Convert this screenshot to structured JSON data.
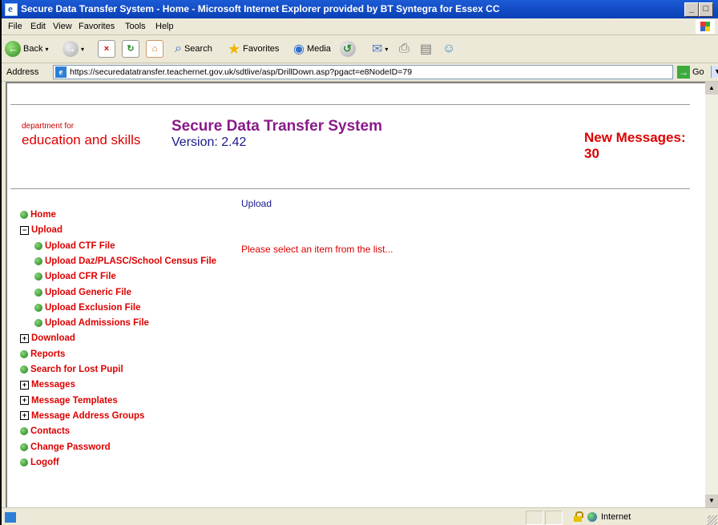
{
  "window": {
    "title": "Secure Data Transfer System - Home - Microsoft Internet Explorer provided by BT Syntegra for Essex CC"
  },
  "menu": [
    "File",
    "Edit",
    "View",
    "Favorites",
    "Tools",
    "Help"
  ],
  "toolbar": {
    "back_label": "Back",
    "search_label": "Search",
    "favorites_label": "Favorites",
    "media_label": "Media"
  },
  "address": {
    "label": "Address",
    "url": "https://securedatatransfer.teachernet.gov.uk/sdtlive/asp/DrillDown.asp?pgact=e8NodeID=79",
    "go_label": "Go"
  },
  "header": {
    "dept_small": "department for",
    "dept_large": "education and skills",
    "system_title": "Secure Data Transfer System",
    "version": "Version: 2.42",
    "new_messages_label": "New Messages:",
    "new_messages_count": "30"
  },
  "nav": [
    {
      "label": "Home",
      "type": "dot",
      "indent": 0
    },
    {
      "label": "Upload",
      "type": "minus",
      "indent": 0
    },
    {
      "label": "Upload CTF File",
      "type": "dot",
      "indent": 1
    },
    {
      "label": "Upload Daz/PLASC/School Census File",
      "type": "dot",
      "indent": 1
    },
    {
      "label": "Upload CFR File",
      "type": "dot",
      "indent": 1
    },
    {
      "label": "Upload Generic File",
      "type": "dot",
      "indent": 1
    },
    {
      "label": "Upload Exclusion File",
      "type": "dot",
      "indent": 1
    },
    {
      "label": "Upload Admissions File",
      "type": "dot",
      "indent": 1
    },
    {
      "label": "Download",
      "type": "plus",
      "indent": 0
    },
    {
      "label": "Reports",
      "type": "dot",
      "indent": 0
    },
    {
      "label": "Search for Lost Pupil",
      "type": "dot",
      "indent": 0
    },
    {
      "label": "Messages",
      "type": "plus",
      "indent": 0
    },
    {
      "label": "Message Templates",
      "type": "plus",
      "indent": 0
    },
    {
      "label": "Message Address Groups",
      "type": "plus",
      "indent": 0
    },
    {
      "label": "Contacts",
      "type": "dot",
      "indent": 0
    },
    {
      "label": "Change Password",
      "type": "dot",
      "indent": 0
    },
    {
      "label": "Logoff",
      "type": "dot",
      "indent": 0
    }
  ],
  "main": {
    "breadcrumb": "Upload",
    "prompt": "Please select an item from the list..."
  },
  "status": {
    "zone": "Internet"
  },
  "colors": {
    "link_red": "#dd0000",
    "title_purple": "#8a1a8a",
    "version_blue": "#1a1a8a"
  }
}
